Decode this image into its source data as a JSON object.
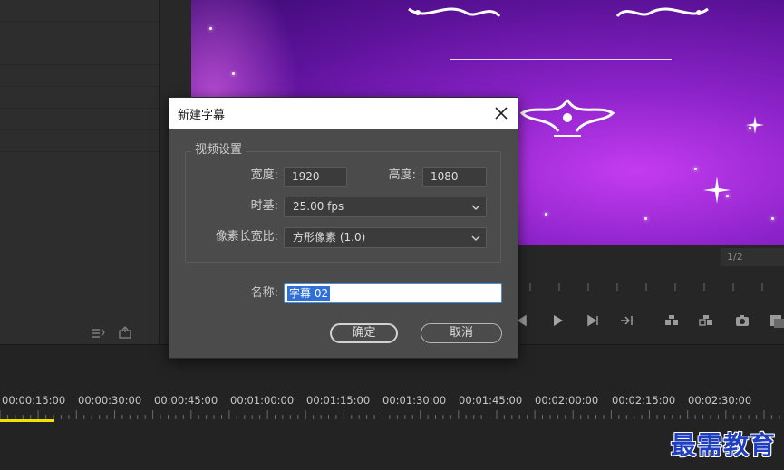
{
  "dialog": {
    "title": "新建字幕",
    "close_icon": "close-icon",
    "video_settings": {
      "group_title": "视频设置",
      "width_label": "宽度:",
      "width_value": "1920",
      "height_label": "高度:",
      "height_value": "1080",
      "timebase_label": "时基:",
      "timebase_value": "25.00 fps",
      "pixel_aspect_label": "像素长宽比:",
      "pixel_aspect_value": "方形像素 (1.0)"
    },
    "name_label": "名称:",
    "name_value": "字幕 02",
    "ok_label": "确定",
    "cancel_label": "取消"
  },
  "monitor": {
    "page_indicator": "1/2"
  },
  "timeline": {
    "timecodes": [
      "00:00:15:00",
      "00:00:30:00",
      "00:00:45:00",
      "00:01:00:00",
      "00:01:15:00",
      "00:01:30:00",
      "00:01:45:00",
      "00:02:00:00",
      "00:02:15:00",
      "00:02:30:00"
    ]
  },
  "watermark": "最需教育",
  "colors": {
    "dialog_bg": "#4b4b4b",
    "title_bar": "#ffffff",
    "selection": "#2f6fd6",
    "playhead": "#f2e000",
    "watermark": "#1f3fbf"
  }
}
